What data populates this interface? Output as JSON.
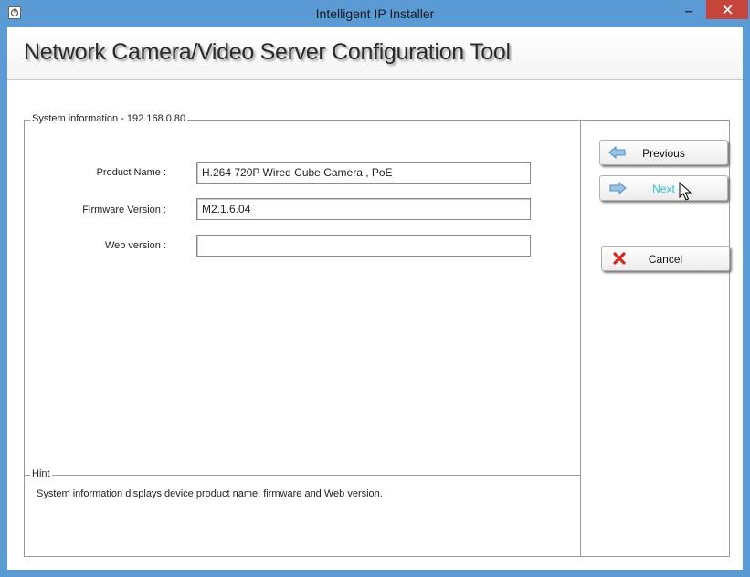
{
  "window": {
    "title": "Intelligent IP Installer"
  },
  "header": {
    "title": "Network Camera/Video Server Configuration Tool"
  },
  "system_info": {
    "legend": "System information - 192.168.0.80",
    "fields": [
      {
        "label": "Product Name :",
        "value": "H.264 720P Wired Cube Camera , PoE"
      },
      {
        "label": "Firmware Version :",
        "value": "M2.1.6.04"
      },
      {
        "label": "Web version :",
        "value": ""
      }
    ]
  },
  "hint": {
    "legend": "Hint",
    "text": "System information displays device product name, firmware and Web version."
  },
  "buttons": {
    "previous": {
      "label": "Previous",
      "icon": "arrow-left-icon"
    },
    "next": {
      "label": "Next",
      "icon": "arrow-right-icon"
    },
    "cancel": {
      "label": "Cancel",
      "icon": "red-x-icon"
    }
  },
  "colors": {
    "titlebar": "#5b9bd5",
    "close_button": "#c7453b",
    "arrow_icon": "#4a90c8",
    "cancel_icon": "#d9261c",
    "next_hover_text": "#2ec4d0"
  }
}
